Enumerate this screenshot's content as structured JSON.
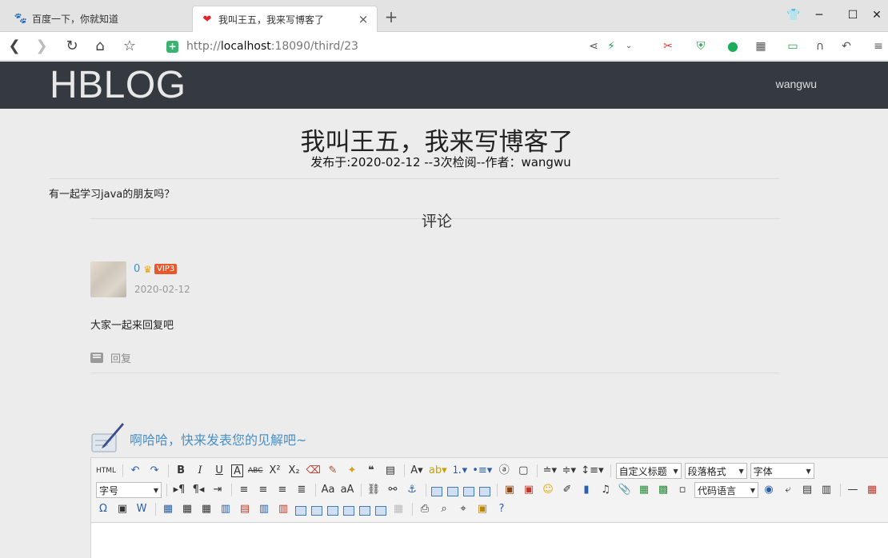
{
  "browser": {
    "tabs": [
      {
        "title": "百度一下，你就知道",
        "icon": "baidu-paw-icon",
        "active": false
      },
      {
        "title": "我叫王五，我来写博客了",
        "icon": "heart-icon",
        "active": true
      }
    ],
    "new_tab": "+",
    "url": {
      "prefix": "http://",
      "host": "localhost",
      "rest": ":18090/third/23"
    }
  },
  "site": {
    "logo": "HBLOG",
    "user": "wangwu"
  },
  "post": {
    "title": "我叫王五，我来写博客了",
    "meta": "发布于:2020-02-12 --3次检阅--作者：wangwu",
    "body": "有一起学习java的朋友吗？"
  },
  "comments": {
    "section_title": "评论",
    "items": [
      {
        "user": "0",
        "vip": "VIP3",
        "date": "2020-02-12",
        "text": "大家一起来回复吧",
        "reply_label": "回复"
      }
    ]
  },
  "editor": {
    "prompt": "啊哈哈，快来发表您的见解吧~",
    "html_label": "HTML",
    "combos": {
      "custom_title": "自定义标题",
      "paragraph": "段落格式",
      "font": "字体",
      "font_size": "字号",
      "code_lang": "代码语言"
    }
  },
  "colors": {
    "header_bg": "#353a40",
    "link_blue": "#3b8ed6",
    "vip_badge": "#e9572b",
    "prompt_blue": "#4a8fc6"
  }
}
